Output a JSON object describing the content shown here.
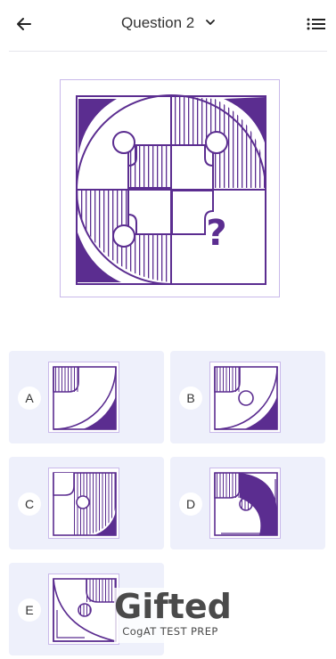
{
  "header": {
    "back_icon": "arrow-left-icon",
    "title": "Question 2",
    "dropdown_icon": "chevron-down-icon",
    "menu_icon": "list-icon"
  },
  "question": {
    "missing_marker": "?"
  },
  "options": [
    {
      "label": "A"
    },
    {
      "label": "B"
    },
    {
      "label": "C"
    },
    {
      "label": "D"
    },
    {
      "label": "E"
    }
  ],
  "watermark": {
    "brand": "Gifted",
    "tagline": "CogAT TEST PREP"
  },
  "colors": {
    "accent": "#5b2d90",
    "figure_border": "#c9b9ea",
    "option_bg": "#eef0fb"
  }
}
